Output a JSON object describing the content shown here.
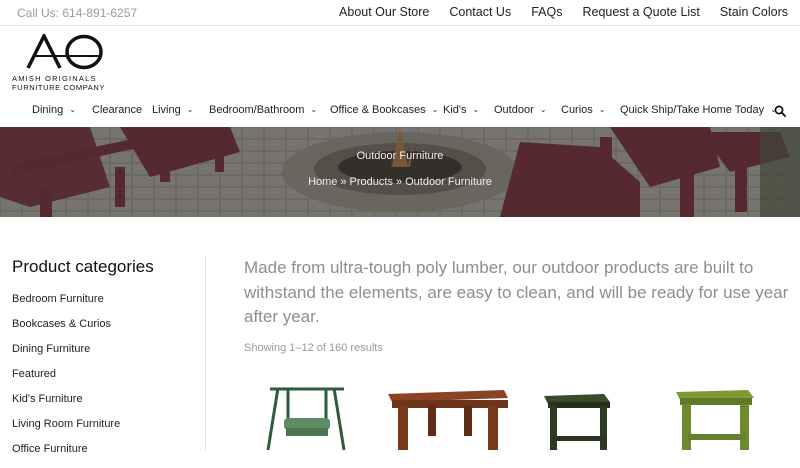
{
  "topbar": {
    "phone": "Call Us: 614-891-6257",
    "links": [
      "About Our Store",
      "Contact Us",
      "FAQs",
      "Request a Quote List",
      "Stain Colors"
    ]
  },
  "logo": {
    "mark": "AO",
    "line1": "AMISH ORIGINALS",
    "line2": "FURNITURE COMPANY"
  },
  "nav": {
    "items": [
      {
        "label": "Dining",
        "dropdown": true
      },
      {
        "label": "Clearance",
        "dropdown": false
      },
      {
        "label": "Living",
        "dropdown": true
      },
      {
        "label": "Bedroom/Bathroom",
        "dropdown": true
      },
      {
        "label": "Office & Bookcases",
        "dropdown": true
      },
      {
        "label": "Kid's",
        "dropdown": true
      },
      {
        "label": "Outdoor",
        "dropdown": true
      },
      {
        "label": "Curios",
        "dropdown": true
      },
      {
        "label": "Quick Ship/Take Home Today",
        "dropdown": true
      }
    ],
    "search_icon": "search-icon"
  },
  "hero": {
    "title": "Outdoor Furniture",
    "breadcrumb": [
      "Home",
      "Products",
      "Outdoor Furniture"
    ],
    "separator": "»"
  },
  "sidebar": {
    "heading": "Product categories",
    "categories": [
      "Bedroom Furniture",
      "Bookcases & Curios",
      "Dining Furniture",
      "Featured",
      "Kid's Furniture",
      "Living Room Furniture",
      "Office Furniture"
    ]
  },
  "main": {
    "intro": "Made from ultra-tough poly lumber, our outdoor products are built to withstand the elements, are easy to clean, and will be ready for use year after year.",
    "result_count": "Showing 1–12 of 160 results"
  },
  "products": [
    {
      "name": "porch-swing",
      "color": "#2f5a3c"
    },
    {
      "name": "dining-table",
      "color": "#7a3a1e"
    },
    {
      "name": "end-table",
      "color": "#2f3a22"
    },
    {
      "name": "side-table",
      "color": "#6e8a2c"
    }
  ],
  "colors": {
    "adirondack_chair": "#6d2a33",
    "muted_text": "#8e8e8e"
  }
}
